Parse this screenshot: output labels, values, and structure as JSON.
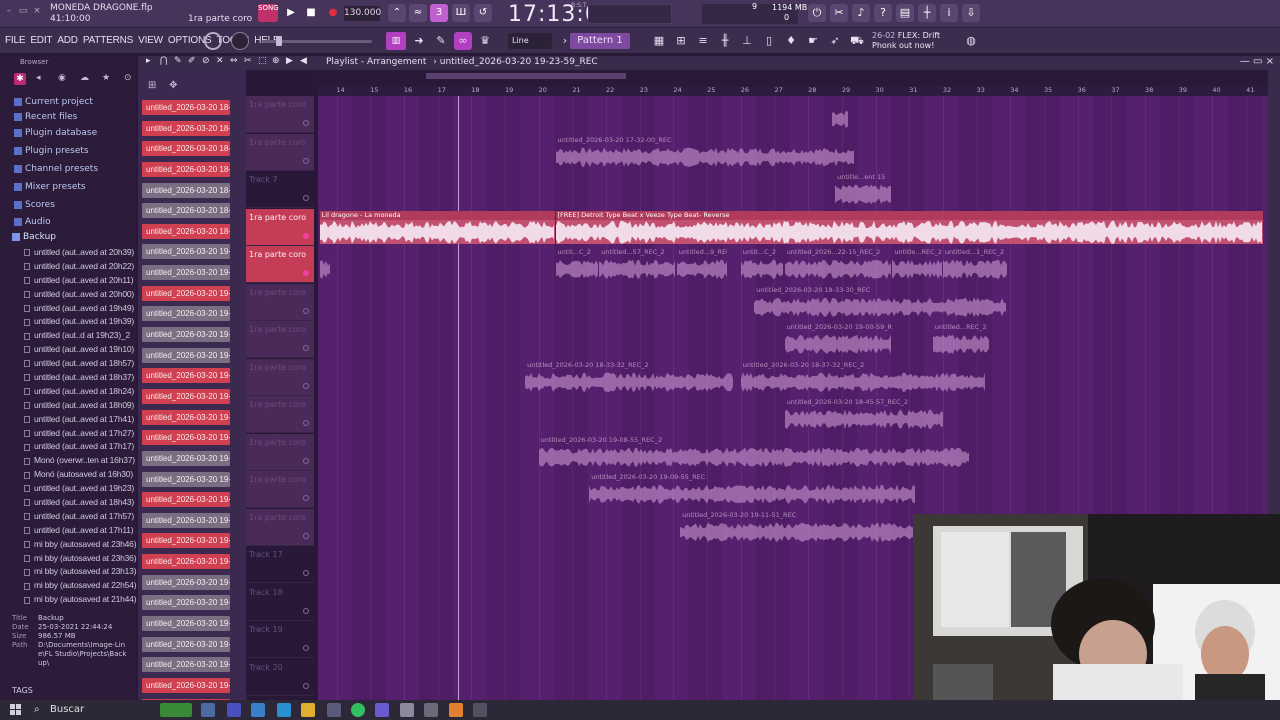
{
  "window": {
    "song_name": "MONEDA DRAGONE.flp",
    "song_time": "41:10:00",
    "hint": "1ra parte coro"
  },
  "transport": {
    "song_label": "SONG",
    "tempo": "130.000",
    "clock": "17:13:00",
    "clock_unit": "B:S:T",
    "cpu": "9",
    "memory": "1194 MB",
    "polyphony": "0"
  },
  "menu": [
    "FILE",
    "EDIT",
    "ADD",
    "PATTERNS",
    "VIEW",
    "OPTIONS",
    "TOOLS",
    "HELP"
  ],
  "toolbar": {
    "snap": "Line",
    "pattern": "Pattern 1",
    "news_date": "26-02",
    "news_text": "FLEX: Drift Phonk out now!"
  },
  "browser": {
    "header": "Browser",
    "tree": [
      "Current project",
      "Recent files",
      "Plugin database",
      "Plugin presets",
      "Channel presets",
      "Mixer presets",
      "Scores",
      "Audio",
      "Backup"
    ],
    "files": [
      "untitled (aut..aved at 20h39)",
      "untitled (aut..aved at 20h22)",
      "untitled (aut..aved at 20h11)",
      "untitled (aut..aved at 20h00)",
      "untitled (aut..aved at 19h49)",
      "untitled (aut..aved at 19h39)",
      "untitled (aut..d at 19h23)_2",
      "untitled (aut..aved at 19h10)",
      "untitled (aut..aved at 18h57)",
      "untitled (aut..aved at 18h37)",
      "untitled (aut..aved at 18h24)",
      "untitled (aut..aved at 18h09)",
      "untitled (aut..aved at 17h41)",
      "untitled (aut..aved at 17h27)",
      "untitled (aut..aved at 17h17)",
      "Monó (overwr..ten at 16h37)",
      "Monó (autosaved at 16h30)",
      "untitled (aut..aved at 19h23)",
      "untitled (aut..aved at 18h43)",
      "untitled (aut..aved at 17h57)",
      "untitled (aut..aved at 17h11)",
      "mi bby (autosaved at 23h46)",
      "mi bby (autosaved at 23h36)",
      "mi bby (autosaved at 23h13)",
      "mi bby (autosaved at 22h54)",
      "mi bby (autosaved at 21h44)"
    ],
    "info": {
      "title_k": "Title",
      "title": "Backup",
      "date_k": "Date",
      "date": "25-03-2021 22:44:24",
      "size_k": "Size",
      "size": "986.57 MB",
      "path_k": "Path",
      "path": "D:\\Documents\\Image-Line\\FL Studio\\Projects\\Backup\\"
    },
    "tags": "TAGS"
  },
  "playlist": {
    "title": "Playlist - Arrangement",
    "file": "untitled_2026-03-20 19-23-59_REC",
    "picker": [
      {
        "label": "untitled_2026-03-20 18-",
        "color": "red"
      },
      {
        "label": "untitled_2026-03-20 18-",
        "color": "red"
      },
      {
        "label": "untitled_2026-03-20 18-",
        "color": "red"
      },
      {
        "label": "untitled_2026-03-20 18-",
        "color": "red"
      },
      {
        "label": "untitled_2026-03-20 18-",
        "color": "gray"
      },
      {
        "label": "untitled_2026-03-20 18-",
        "color": "gray"
      },
      {
        "label": "untitled_2026-03-20 18-",
        "color": "red"
      },
      {
        "label": "untitled_2026-03-20 19-",
        "color": "gray"
      },
      {
        "label": "untitled_2026-03-20 19-",
        "color": "gray"
      },
      {
        "label": "untitled_2026-03-20 19-",
        "color": "red"
      },
      {
        "label": "untitled_2026-03-20 19-",
        "color": "gray"
      },
      {
        "label": "untitled_2026-03-20 19-",
        "color": "gray"
      },
      {
        "label": "untitled_2026-03-20 19-",
        "color": "gray"
      },
      {
        "label": "untitled_2026-03-20 19-",
        "color": "red"
      },
      {
        "label": "untitled_2026-03-20 19-",
        "color": "red"
      },
      {
        "label": "untitled_2026-03-20 19-",
        "color": "red"
      },
      {
        "label": "untitled_2026-03-20 19-",
        "color": "red"
      },
      {
        "label": "untitled_2026-03-20 19-",
        "color": "gray"
      },
      {
        "label": "untitled_2026-03-20 19-",
        "color": "gray"
      },
      {
        "label": "untitled_2026-03-20 19-",
        "color": "red"
      },
      {
        "label": "untitled_2026-03-20 19-",
        "color": "gray"
      },
      {
        "label": "untitled_2026-03-20 19-",
        "color": "red"
      },
      {
        "label": "untitled_2026-03-20 19-",
        "color": "red"
      },
      {
        "label": "untitled_2026-03-20 19-",
        "color": "gray"
      },
      {
        "label": "untitled_2026-03-20 19-",
        "color": "gray"
      },
      {
        "label": "untitled_2026-03-20 19-",
        "color": "gray"
      },
      {
        "label": "untitled_2026-03-20 19-",
        "color": "gray"
      },
      {
        "label": "untitled_2026-03-20 19-",
        "color": "gray"
      },
      {
        "label": "untitled_2026-03-20 19-",
        "color": "red"
      },
      {
        "label": "untitled_2026-03-20 19-",
        "color": "red"
      }
    ],
    "tracks": [
      {
        "name": "1ra parte coro",
        "style": "dark"
      },
      {
        "name": "1ra parte coro",
        "style": "dark"
      },
      {
        "name": "Track 7",
        "style": "none"
      },
      {
        "name": "1ra parte coro",
        "style": "red"
      },
      {
        "name": "1ra parte coro",
        "style": "red"
      },
      {
        "name": "1ra parte coro",
        "style": "dark"
      },
      {
        "name": "1ra parte coro",
        "style": "dark"
      },
      {
        "name": "1ra parte coro",
        "style": "dark"
      },
      {
        "name": "1ra parte coro",
        "style": "dark"
      },
      {
        "name": "1ra parte coro",
        "style": "dark"
      },
      {
        "name": "1ra parte coro",
        "style": "dark"
      },
      {
        "name": "1ra parte coro",
        "style": "dark"
      },
      {
        "name": "Track 17",
        "style": "none"
      },
      {
        "name": "Track 18",
        "style": "none"
      },
      {
        "name": "Track 19",
        "style": "none"
      },
      {
        "name": "Track 20",
        "style": "none"
      },
      {
        "name": "Track 21",
        "style": "none"
      }
    ],
    "ruler_first_bar": 14,
    "ruler_last_bar": 41,
    "clips": [
      {
        "label": "",
        "lane": 0,
        "start": 28.7,
        "end": 29.2,
        "style": "faint"
      },
      {
        "label": "untitled_2026-03-20 17-32-00_REC",
        "lane": 1,
        "start": 20.5,
        "end": 29.4,
        "style": "faint"
      },
      {
        "label": "untitle...ent 15",
        "lane": 2,
        "start": 28.8,
        "end": 30.5,
        "style": "faint"
      },
      {
        "label": "Lil dragone - La moneda",
        "lane": 3,
        "start": 13.5,
        "end": 20.5,
        "style": "bright"
      },
      {
        "label": "[FREE] Detroit Type Beat x Veeze Type Beat- Reverse",
        "lane": 3,
        "start": 20.5,
        "end": 41.5,
        "style": "bright"
      },
      {
        "label": "",
        "lane": 4,
        "start": 13.5,
        "end": 13.8,
        "style": "faint"
      },
      {
        "label": "untit...C_2",
        "lane": 4,
        "start": 20.5,
        "end": 21.8,
        "style": "faint"
      },
      {
        "label": "untitled...57_REC_2",
        "lane": 4,
        "start": 21.8,
        "end": 24.1,
        "style": "faint"
      },
      {
        "label": "untitled...9_REC",
        "lane": 4,
        "start": 24.1,
        "end": 25.6,
        "style": "faint"
      },
      {
        "label": "untit...C_2",
        "lane": 4,
        "start": 26.0,
        "end": 27.3,
        "style": "faint"
      },
      {
        "label": "untitled_2026...22-15_REC_2",
        "lane": 4,
        "start": 27.3,
        "end": 30.5,
        "style": "faint"
      },
      {
        "label": "untitle...REC_2",
        "lane": 4,
        "start": 30.5,
        "end": 32.0,
        "style": "faint"
      },
      {
        "label": "untitled...1_REC_2",
        "lane": 4,
        "start": 32.0,
        "end": 33.9,
        "style": "faint"
      },
      {
        "label": "untitled_2026-03-20 18-33-30_REC",
        "lane": 5,
        "start": 26.4,
        "end": 33.9,
        "style": "faint"
      },
      {
        "label": "untitled_2026-03-20 19-00-59_REC",
        "lane": 6,
        "start": 27.3,
        "end": 30.5,
        "style": "faint"
      },
      {
        "label": "untitled...REC_2",
        "lane": 6,
        "start": 31.7,
        "end": 33.4,
        "style": "faint"
      },
      {
        "label": "untitled_2026-03-20 18-33-32_REC_2",
        "lane": 7,
        "start": 19.6,
        "end": 25.8,
        "style": "faint"
      },
      {
        "label": "untitled_2026-03-20 18-37-32_REC_2",
        "lane": 7,
        "start": 26.0,
        "end": 33.3,
        "style": "faint"
      },
      {
        "label": "untitled_2026-03-20 18-45-57_REC_2",
        "lane": 8,
        "start": 27.3,
        "end": 32.0,
        "style": "faint"
      },
      {
        "label": "untitled_2026-03-20 19-08-55_REC_2",
        "lane": 9,
        "start": 20.0,
        "end": 32.8,
        "style": "faint"
      },
      {
        "label": "untitled_2026-03-20 19-09-55_REC",
        "lane": 10,
        "start": 21.5,
        "end": 31.2,
        "style": "faint"
      },
      {
        "label": "untitled_2026-03-20 19-11-51_REC",
        "lane": 11,
        "start": 24.2,
        "end": 32.5,
        "style": "faint"
      }
    ]
  },
  "taskbar": {
    "search": "Buscar"
  },
  "colors": {
    "accent": "#c43c56",
    "grid_a": "#57206f",
    "grid_b": "#4f1c66",
    "clip_wave": "#d6a2d8",
    "clip_bright": "#c25070"
  }
}
